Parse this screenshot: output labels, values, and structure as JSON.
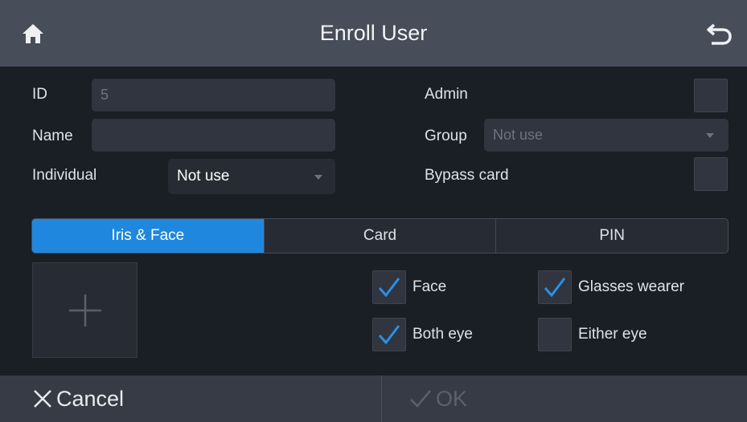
{
  "header": {
    "title": "Enroll User",
    "home_icon": "home-icon",
    "back_icon": "back-arrow-icon"
  },
  "form": {
    "id_label": "ID",
    "id_value": "5",
    "name_label": "Name",
    "name_value": "",
    "individual_label": "Individual",
    "individual_value": "Not use",
    "admin_label": "Admin",
    "admin_checked": false,
    "group_label": "Group",
    "group_value": "Not use",
    "bypass_label": "Bypass card",
    "bypass_checked": false
  },
  "tabs": [
    {
      "label": "Iris & Face",
      "active": true
    },
    {
      "label": "Card",
      "active": false
    },
    {
      "label": "PIN",
      "active": false
    }
  ],
  "options": {
    "face": {
      "label": "Face",
      "checked": true
    },
    "glasses": {
      "label": "Glasses wearer",
      "checked": true
    },
    "both_eye": {
      "label": "Both eye",
      "checked": true
    },
    "either_eye": {
      "label": "Either eye",
      "checked": false
    }
  },
  "footer": {
    "cancel_label": "Cancel",
    "ok_label": "OK"
  },
  "colors": {
    "accent": "#1f88de",
    "header_bg": "#474e5a",
    "background": "#1a1e25",
    "footer_bg": "#363b45",
    "disabled_text": "#5b616c"
  }
}
